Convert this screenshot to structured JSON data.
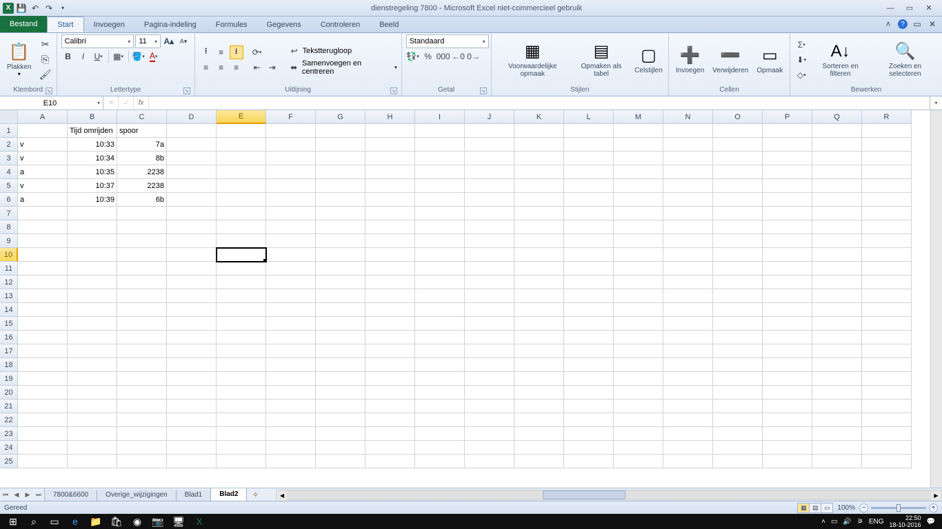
{
  "titlebar": {
    "title": "dienstregeling 7800 - Microsoft Excel niet-commercieel gebruik"
  },
  "tabs": {
    "file": "Bestand",
    "list": [
      "Start",
      "Invoegen",
      "Pagina-indeling",
      "Formules",
      "Gegevens",
      "Controleren",
      "Beeld"
    ],
    "active": "Start"
  },
  "ribbon": {
    "clipboard": {
      "paste": "Plakken",
      "label": "Klembord"
    },
    "font": {
      "name": "Calibri",
      "size": "11",
      "label": "Lettertype"
    },
    "align": {
      "wrap": "Tekstterugloop",
      "merge": "Samenvoegen en centreren",
      "label": "Uitlijning"
    },
    "number": {
      "format": "Standaard",
      "label": "Getal"
    },
    "styles": {
      "cond": "Voorwaardelijke opmaak",
      "table": "Opmaken als tabel",
      "cell": "Celstijlen",
      "label": "Stijlen"
    },
    "cells": {
      "insert": "Invoegen",
      "delete": "Verwijderen",
      "format": "Opmaak",
      "label": "Cellen"
    },
    "editing": {
      "sort": "Sorteren en filteren",
      "find": "Zoeken en selecteren",
      "label": "Bewerken"
    }
  },
  "namebox": "E10",
  "columns": [
    "A",
    "B",
    "C",
    "D",
    "E",
    "F",
    "G",
    "H",
    "I",
    "J",
    "K",
    "L",
    "M",
    "N",
    "O",
    "P",
    "Q",
    "R"
  ],
  "sel_col": "E",
  "sel_row": 10,
  "rows": 25,
  "data": {
    "1": {
      "B": {
        "v": "Tijd omrijden",
        "a": "l"
      },
      "C": {
        "v": "spoor",
        "a": "l"
      }
    },
    "2": {
      "A": {
        "v": "v",
        "a": "l"
      },
      "B": {
        "v": "10:33",
        "a": "r"
      },
      "C": {
        "v": "7a",
        "a": "r"
      }
    },
    "3": {
      "A": {
        "v": "v",
        "a": "l"
      },
      "B": {
        "v": "10:34",
        "a": "r"
      },
      "C": {
        "v": "8b",
        "a": "r"
      }
    },
    "4": {
      "A": {
        "v": "a",
        "a": "l"
      },
      "B": {
        "v": "10:35",
        "a": "r"
      },
      "C": {
        "v": "2238",
        "a": "r"
      }
    },
    "5": {
      "A": {
        "v": "v",
        "a": "l"
      },
      "B": {
        "v": "10:37",
        "a": "r"
      },
      "C": {
        "v": "2238",
        "a": "r"
      }
    },
    "6": {
      "A": {
        "v": "a",
        "a": "l"
      },
      "B": {
        "v": "10:39",
        "a": "r"
      },
      "C": {
        "v": "6b",
        "a": "r"
      }
    }
  },
  "sheets": {
    "list": [
      "7800&6600",
      "Overige_wijzigingen",
      "Blad1",
      "Blad2"
    ],
    "active": "Blad2"
  },
  "status": {
    "ready": "Gereed",
    "zoom": "100%"
  },
  "taskbar": {
    "lang": "ENG",
    "time": "22:50",
    "date": "18-10-2016"
  }
}
